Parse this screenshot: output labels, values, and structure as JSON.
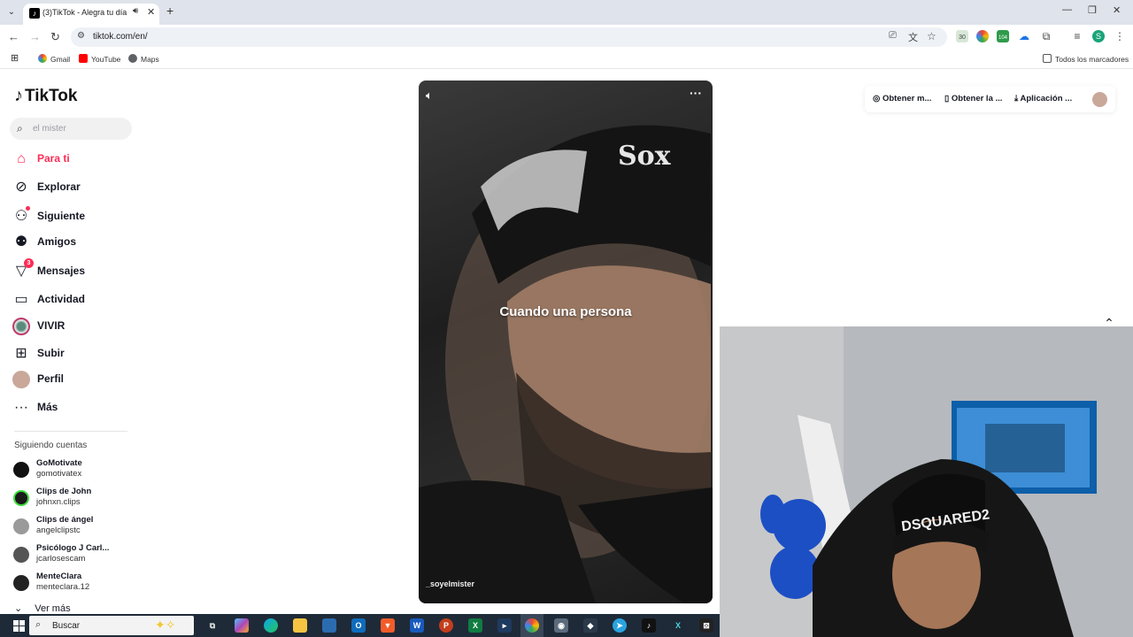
{
  "browser": {
    "tab_title": "(3)TikTok - Alegra tu día",
    "url": "tiktok.com/en/",
    "tab_list_icon": "chevron-down-icon",
    "ext_badges": {
      "ext1": "30",
      "ext3": "104"
    },
    "profile_letter": "S",
    "bookmarks": [
      "Gmail",
      "YouTube",
      "Maps"
    ],
    "bookmarks_folder": "Todos los marcadores"
  },
  "tiktok": {
    "logo": "TikTok",
    "search_placeholder": "el mister",
    "nav": [
      {
        "label": "Para ti",
        "icon": "home-icon",
        "active": true
      },
      {
        "label": "Explorar",
        "icon": "compass-icon"
      },
      {
        "label": "Siguiente",
        "icon": "following-icon"
      },
      {
        "label": "Amigos",
        "icon": "friends-icon"
      },
      {
        "label": "Mensajes",
        "icon": "messages-icon",
        "badge": "3"
      },
      {
        "label": "Actividad",
        "icon": "activity-icon"
      },
      {
        "label": "VIVIR",
        "icon": "live-icon"
      },
      {
        "label": "Subir",
        "icon": "upload-icon"
      },
      {
        "label": "Perfil",
        "icon": "profile-icon"
      },
      {
        "label": "Más",
        "icon": "more-icon"
      }
    ],
    "following_title": "Siguiendo cuentas",
    "following": [
      {
        "name": "GoMotivate",
        "user": "gomotivatex"
      },
      {
        "name": "Clips de John",
        "user": "johnxn.clips"
      },
      {
        "name": "Clips de ángel",
        "user": "angelclipstc"
      },
      {
        "name": "Psicólogo J Carl...",
        "user": "jcarlosescam"
      },
      {
        "name": "MenteClara",
        "user": "menteclara.12"
      }
    ],
    "see_more": "Ver más",
    "video": {
      "caption": "Cuando una persona",
      "handle": "_soyelmister"
    },
    "top_actions": [
      "Obtener m...",
      "Obtener la ...",
      "Aplicación ..."
    ]
  },
  "taskbar": {
    "search_label": "Buscar"
  },
  "colors": {
    "accent": "#fe2c55",
    "tab_bar": "#dfe3eb",
    "taskbar": "#1f2a38"
  }
}
